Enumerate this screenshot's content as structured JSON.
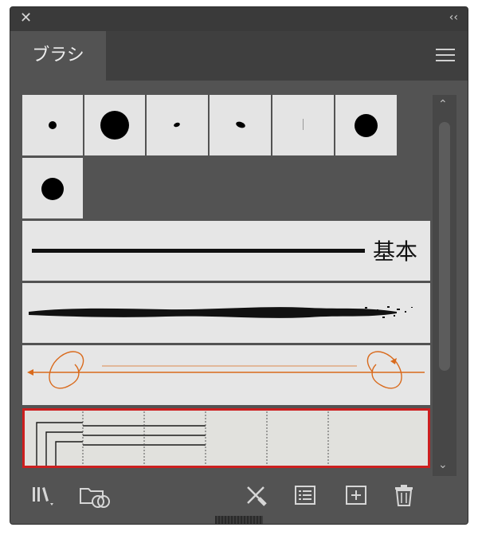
{
  "panel": {
    "tab_label": "ブラシ",
    "basic_brush_label": "基本"
  },
  "icons": {
    "close": "close-icon",
    "collapse": "collapse-icon",
    "menu": "hamburger-menu-icon",
    "library": "brush-libraries-icon",
    "cc_library": "cc-libraries-icon",
    "remove_stroke": "remove-brush-stroke-icon",
    "options": "brush-options-icon",
    "new_brush": "new-brush-icon",
    "delete": "delete-brush-icon"
  },
  "colors": {
    "panel_bg": "#535353",
    "selected_outline": "#cc1f1f",
    "art_brush": "#d96a1c"
  }
}
